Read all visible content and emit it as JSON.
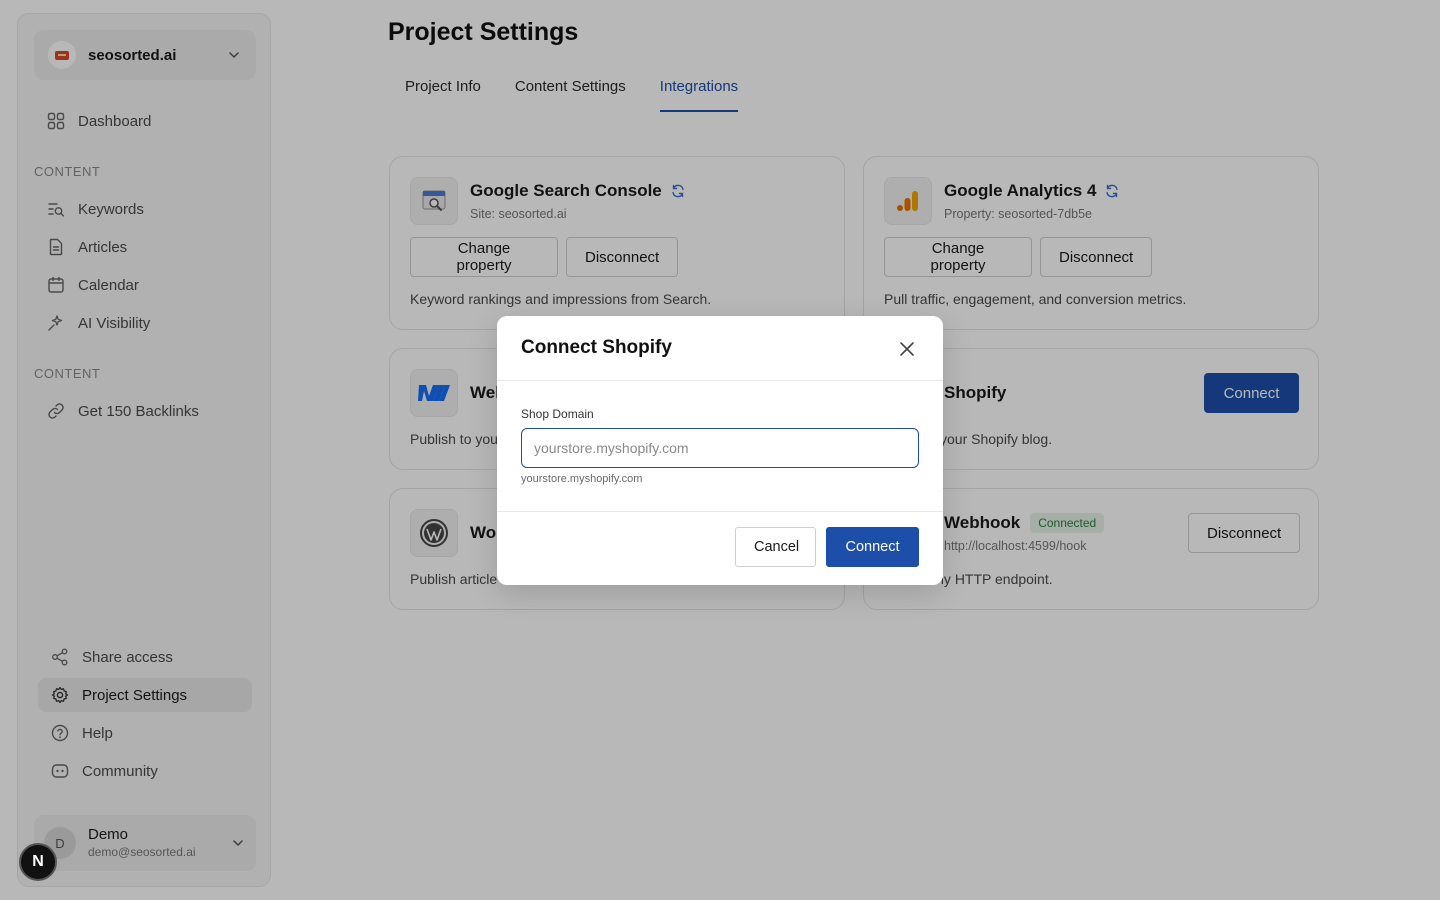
{
  "workspace": {
    "name": "seosorted.ai"
  },
  "nav": {
    "dashboard": "Dashboard",
    "section_content_1": "CONTENT",
    "keywords": "Keywords",
    "articles": "Articles",
    "calendar": "Calendar",
    "ai_visibility": "AI Visibility",
    "section_content_2": "CONTENT",
    "backlinks": "Get 150 Backlinks",
    "share_access": "Share access",
    "project_settings": "Project Settings",
    "help": "Help",
    "community": "Community"
  },
  "user": {
    "initial": "D",
    "name": "Demo",
    "email": "demo@seosorted.ai"
  },
  "dev_badge": "N",
  "page": {
    "title": "Project Settings",
    "tabs": [
      "Project Info",
      "Content Settings",
      "Integrations"
    ],
    "active_tab": "Integrations"
  },
  "integrations": {
    "gsc": {
      "title": "Google Search Console",
      "sub": "Site: seosorted.ai",
      "btn_change": "Change property",
      "btn_disconnect": "Disconnect",
      "desc": "Keyword rankings and impressions from Search."
    },
    "ga4": {
      "title": "Google Analytics 4",
      "sub": "Property: seosorted-7db5e",
      "btn_change": "Change property",
      "btn_disconnect": "Disconnect",
      "desc": "Pull traffic, engagement, and conversion metrics."
    },
    "webflow": {
      "title": "Web",
      "desc": "Publish to you"
    },
    "shopify": {
      "title": "Shopify",
      "btn_connect": "Connect",
      "desc": "rticles to your Shopify blog."
    },
    "wordpress": {
      "title": "Wo",
      "desc": "Publish article"
    },
    "webhook": {
      "title": "Webhook",
      "badge": "Connected",
      "sub": "http://localhost:4599/hook",
      "btn_disconnect": "Disconnect",
      "desc": "cles to any HTTP endpoint."
    }
  },
  "modal": {
    "title": "Connect Shopify",
    "field_label": "Shop Domain",
    "placeholder": "yourstore.myshopify.com",
    "hint": "yourstore.myshopify.com",
    "cancel": "Cancel",
    "connect": "Connect"
  },
  "colors": {
    "accent": "#1d4eaa",
    "connected_green": "#2d7a3e"
  }
}
